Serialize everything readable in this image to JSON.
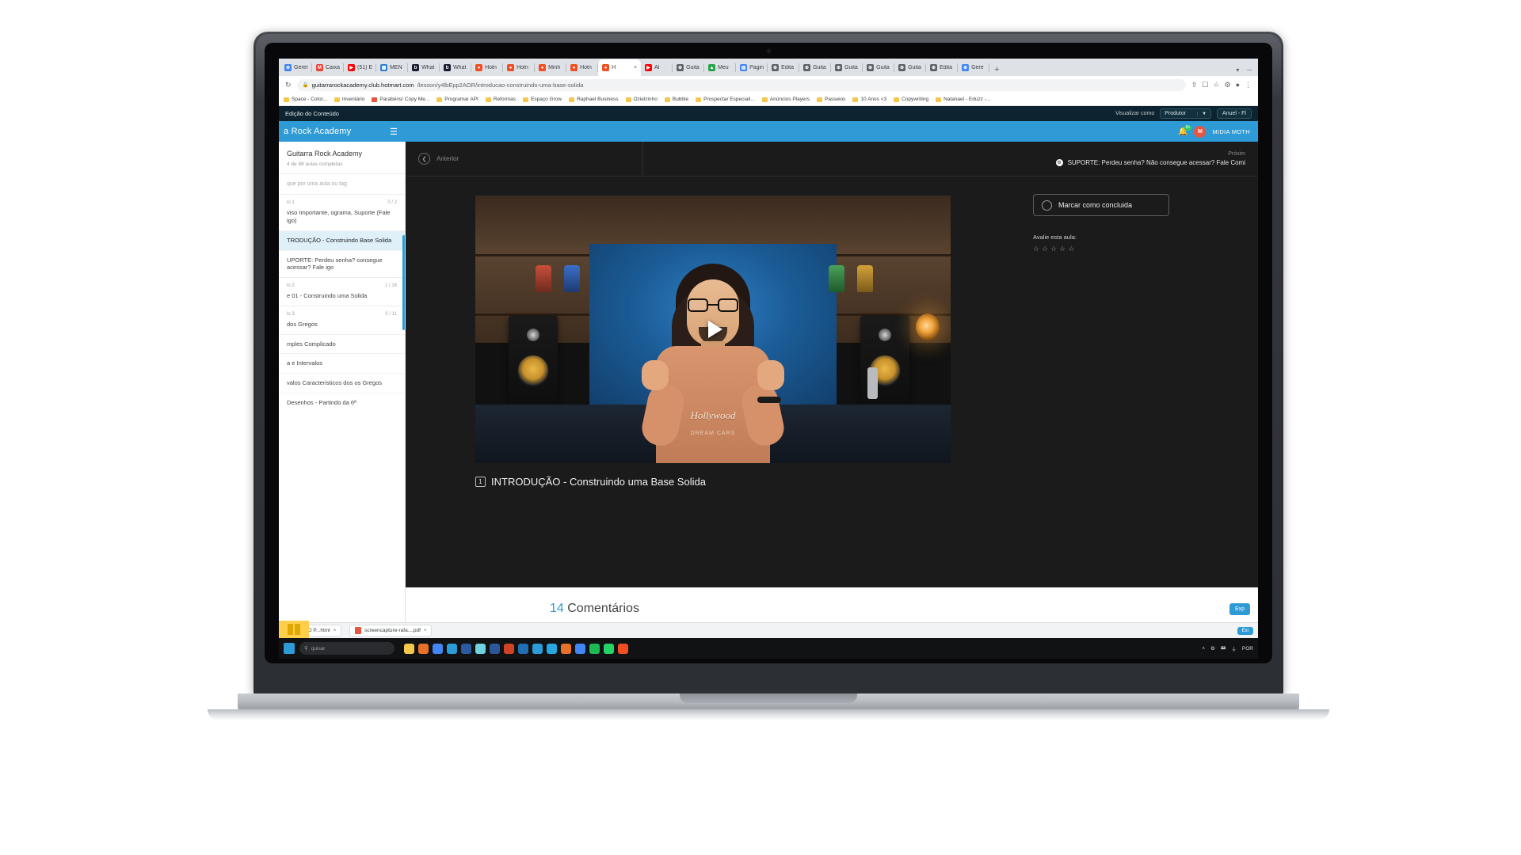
{
  "browser": {
    "tabs": [
      {
        "label": "Gerer",
        "favicon": "globe",
        "color": "#4285f4",
        "active": false
      },
      {
        "label": "Caixa",
        "favicon": "gmail",
        "color": "#ea4335",
        "active": false
      },
      {
        "label": "(51) E",
        "favicon": "youtube",
        "color": "#ff0000",
        "active": false
      },
      {
        "label": "MEN",
        "favicon": "menu-app",
        "color": "#2b7fd4",
        "active": false
      },
      {
        "label": "What",
        "favicon": "blaze",
        "color": "#1a1a2e",
        "active": false
      },
      {
        "label": "What",
        "favicon": "blaze",
        "color": "#1a1a2e",
        "active": false
      },
      {
        "label": "Hotn",
        "favicon": "hotmart",
        "color": "#f04e23",
        "active": false
      },
      {
        "label": "Hotn",
        "favicon": "hotmart",
        "color": "#f04e23",
        "active": false
      },
      {
        "label": "Minh",
        "favicon": "hotmart",
        "color": "#f04e23",
        "active": false
      },
      {
        "label": "Hotn",
        "favicon": "hotmart",
        "color": "#f04e23",
        "active": false
      },
      {
        "label": "H",
        "favicon": "hotmart",
        "color": "#f04e23",
        "active": true
      },
      {
        "label": "Al",
        "favicon": "youtube",
        "color": "#ff0000",
        "active": false
      },
      {
        "label": "Guita",
        "favicon": "globe",
        "color": "#5f6368",
        "active": false
      },
      {
        "label": "Meu",
        "favicon": "drive",
        "color": "#2ba24c",
        "active": false
      },
      {
        "label": "Pagin",
        "favicon": "docs",
        "color": "#4285f4",
        "active": false
      },
      {
        "label": "Edita",
        "favicon": "globe",
        "color": "#5f6368",
        "active": false
      },
      {
        "label": "Guita",
        "favicon": "globe",
        "color": "#5f6368",
        "active": false
      },
      {
        "label": "Guita",
        "favicon": "globe",
        "color": "#5f6368",
        "active": false
      },
      {
        "label": "Guita",
        "favicon": "globe",
        "color": "#5f6368",
        "active": false
      },
      {
        "label": "Guita",
        "favicon": "globe",
        "color": "#5f6368",
        "active": false
      },
      {
        "label": "Edita",
        "favicon": "globe",
        "color": "#5f6368",
        "active": false
      },
      {
        "label": "Gere",
        "favicon": "globe",
        "color": "#4285f4",
        "active": false
      }
    ],
    "new_tab_label": "+",
    "close_tab_label": "×",
    "url_host": "guitarrarockacademy.club.hotmart.com",
    "url_path": "/lesson/y4lbEpp2AOR/introducao-construindo-uma-base-solida",
    "lock_icon": "lock-icon",
    "bookmarks": [
      {
        "label": "Space - Color...",
        "kind": "folder"
      },
      {
        "label": "Inventário",
        "kind": "folder"
      },
      {
        "label": "Parabéns! Copy Me...",
        "kind": "image"
      },
      {
        "label": "Programar API",
        "kind": "folder"
      },
      {
        "label": "Reformas",
        "kind": "folder"
      },
      {
        "label": "Espaço Grow",
        "kind": "folder"
      },
      {
        "label": "Raphael Business",
        "kind": "folder"
      },
      {
        "label": "Ozielzinho",
        "kind": "folder"
      },
      {
        "label": "Bubble",
        "kind": "folder"
      },
      {
        "label": "Prospectar Especiali...",
        "kind": "folder"
      },
      {
        "label": "Anúncios Players",
        "kind": "folder"
      },
      {
        "label": "Passeios",
        "kind": "folder"
      },
      {
        "label": "10 Anos <3",
        "kind": "folder"
      },
      {
        "label": "Copywriting",
        "kind": "folder"
      },
      {
        "label": "Natanael - Eduzz -...",
        "kind": "folder"
      }
    ]
  },
  "adminbar": {
    "title": "Edição do Conteúdo",
    "view_as_label": "Visualizar como",
    "view_as_value": "Produtor",
    "view_as_caret": "▼",
    "user_button": "Anuel - Fl"
  },
  "appbar": {
    "brand": "a Rock Academy",
    "menu_icon": "hamburger-icon",
    "bell_icon": "bell-icon",
    "bell_badge": "9+",
    "avatar_initial": "M",
    "username": "MIDIA MOTH"
  },
  "sidebar": {
    "course_title": "Guitarra Rock Academy",
    "progress_text": "4 de 88 aulas completas",
    "search_placeholder": "que por uma aula ou tag",
    "modules": [
      {
        "label": "lo 1",
        "count": "0 / 2",
        "lessons": [
          {
            "title": "viso Importante, ograma, Suporte (Fale igo)",
            "active": false
          },
          {
            "title": "TRODUÇÃO - Construindo Base Solida",
            "active": true
          },
          {
            "title": "UPORTE: Perdeu senha? consegue acessar? Fale igo",
            "active": false
          }
        ]
      },
      {
        "label": "lo 2",
        "count": "1 / 16",
        "lessons": [
          {
            "title": "e 01 - Construindo uma Solida",
            "active": false
          }
        ]
      },
      {
        "label": "lo 3",
        "count": "0 / 11",
        "lessons": [
          {
            "title": "dos Gregos",
            "active": false
          },
          {
            "title": "mples Complicado",
            "active": false
          },
          {
            "title": "a e Intervalos",
            "active": false
          },
          {
            "title": "valos Caracteristicos dos os Gregos",
            "active": false
          },
          {
            "title": "Desenhos - Partindo da 6ª",
            "active": false
          }
        ]
      }
    ]
  },
  "lesson_nav": {
    "prev_label": "Anterior",
    "prev_icon": "chevron-left-icon",
    "next_label": "Próxim",
    "next_title": "SUPORTE: Perdeu senha? Não consegue acessar? Fale Comi",
    "next_icon": "gear-icon"
  },
  "player": {
    "play_icon": "play-icon",
    "lesson_number": "1",
    "lesson_title": "INTRODUÇÃO - Construindo uma Base Solida",
    "shirt_text": "Hollywood",
    "shirt_sub": "DREAM CARS"
  },
  "rail": {
    "mark_complete_label": "Marcar como concluida",
    "mark_complete_icon": "circle-icon",
    "rate_label": "Avalie esta aula:",
    "stars": [
      "☆",
      "☆",
      "☆",
      "☆",
      "☆"
    ]
  },
  "comments": {
    "count": "14",
    "label": "Comentários",
    "action_button": "Exp"
  },
  "downloads": [
    {
      "label": "IA - O P...html",
      "kind": "html",
      "caret": "˄"
    },
    {
      "label": "screencapture-rafa....pdf",
      "kind": "pdf",
      "caret": "˄"
    }
  ],
  "downloads_right_button": "Exi",
  "taskbar": {
    "search_placeholder": "quisar",
    "search_icon": "search-icon",
    "start_icon": "windows-icon",
    "apps": [
      {
        "name": "file-explorer-icon",
        "color": "#f5c84c"
      },
      {
        "name": "firefox-icon",
        "color": "#e8702a"
      },
      {
        "name": "chrome-icon",
        "color": "#4285f4"
      },
      {
        "name": "edge-icon",
        "color": "#2b9cd8"
      },
      {
        "name": "photoshop-icon",
        "color": "#2c5aa0"
      },
      {
        "name": "canva-icon",
        "color": "#6fd2e0"
      },
      {
        "name": "word-icon",
        "color": "#2b5797"
      },
      {
        "name": "powerpoint-icon",
        "color": "#d04423"
      },
      {
        "name": "mail-icon",
        "color": "#1f6fb2"
      },
      {
        "name": "store-icon",
        "color": "#2b9cd8"
      },
      {
        "name": "telegram-icon",
        "color": "#29a6e0"
      },
      {
        "name": "firefox2-icon",
        "color": "#e8702a"
      },
      {
        "name": "chrome2-icon",
        "color": "#4285f4"
      },
      {
        "name": "spotify-icon",
        "color": "#1db954"
      },
      {
        "name": "whatsapp-icon",
        "color": "#25d366"
      },
      {
        "name": "hotmart-icon",
        "color": "#f04e23"
      }
    ],
    "tray": [
      "˄",
      "⚙",
      "🖴",
      "⏚",
      "POR"
    ]
  }
}
